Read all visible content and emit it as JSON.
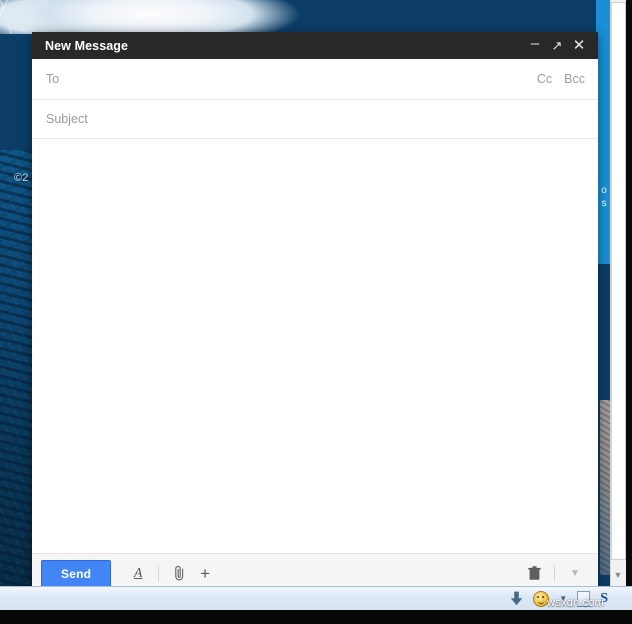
{
  "desktop": {
    "copyright_text": "©2",
    "wallpaper_name": "iceberg-wallpaper"
  },
  "background_page": {
    "sidebar_text_line1": "o",
    "sidebar_text_line2": "s",
    "scrollbar_down_arrow": "▼"
  },
  "compose_window": {
    "title": "New Message",
    "window_controls": {
      "minimize": "–",
      "expand": "↗",
      "close": "✕"
    },
    "to_field": {
      "placeholder": "To",
      "value": ""
    },
    "cc_label": "Cc",
    "bcc_label": "Bcc",
    "subject_field": {
      "placeholder": "Subject",
      "value": ""
    },
    "body_field": {
      "placeholder": "",
      "value": ""
    },
    "toolbar": {
      "send_label": "Send",
      "format_icon": "A",
      "attach_icon": "📎",
      "insert_more_icon": "+",
      "discard_icon": "🗑",
      "more_options_icon": "▼"
    },
    "accent_color": "#4285f4",
    "titlebar_color": "#282828"
  },
  "taskbar": {
    "tray": {
      "download_icon": "⬇",
      "smiley_icon": "smiley",
      "chevron_icon": "▼",
      "document_icon": "document",
      "s_icon": "S"
    }
  },
  "watermark": {
    "text": "wsxdn.com"
  }
}
